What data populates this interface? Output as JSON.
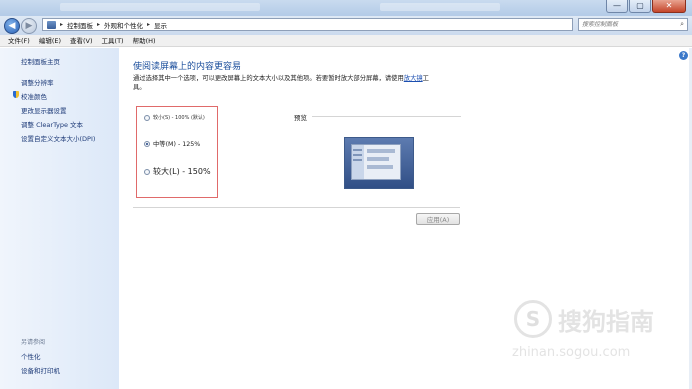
{
  "window": {
    "buttons": {
      "minimize": "—",
      "maximize": "▢",
      "close": "✕"
    }
  },
  "address": {
    "back": "◀",
    "forward": "▶",
    "crumbs": [
      "控制面板",
      "外观和个性化",
      "显示"
    ],
    "separator": "▸",
    "search_placeholder": "搜索控制面板",
    "search_icon": "⌕"
  },
  "menubar": {
    "items": [
      "文件(F)",
      "编辑(E)",
      "查看(V)",
      "工具(T)",
      "帮助(H)"
    ]
  },
  "sidebar": {
    "home": "控制面板主页",
    "items": [
      "调整分辨率",
      "校准颜色",
      "更改显示器设置",
      "调整 ClearType 文本",
      "设置自定义文本大小(DPI)"
    ],
    "see_also_title": "另请参阅",
    "see_also": [
      "个性化",
      "设备和打印机"
    ]
  },
  "main": {
    "help": "?",
    "title": "使阅读屏幕上的内容更容易",
    "description_prefix": "通过选择其中一个选项，可以更改屏幕上的文本大小以及其他项。若要暂时放大部分屏幕，请使用",
    "description_link": "放大镜",
    "description_suffix": "工具。",
    "options": [
      {
        "label": "较小(S) - 100% (默认)",
        "selected": false
      },
      {
        "label": "中等(M) - 125%",
        "selected": true
      },
      {
        "label": "较大(L) - 150%",
        "selected": false
      }
    ],
    "preview_label": "预览",
    "apply_button": "应用(A)"
  },
  "watermark": {
    "name": "搜狗指南",
    "url": "zhinan.sogou.com",
    "logo_glyph": "S"
  },
  "colors": {
    "title_blue": "#1c4f9c",
    "link_blue": "#1e3b78",
    "highlight_red": "#e06a6a"
  }
}
